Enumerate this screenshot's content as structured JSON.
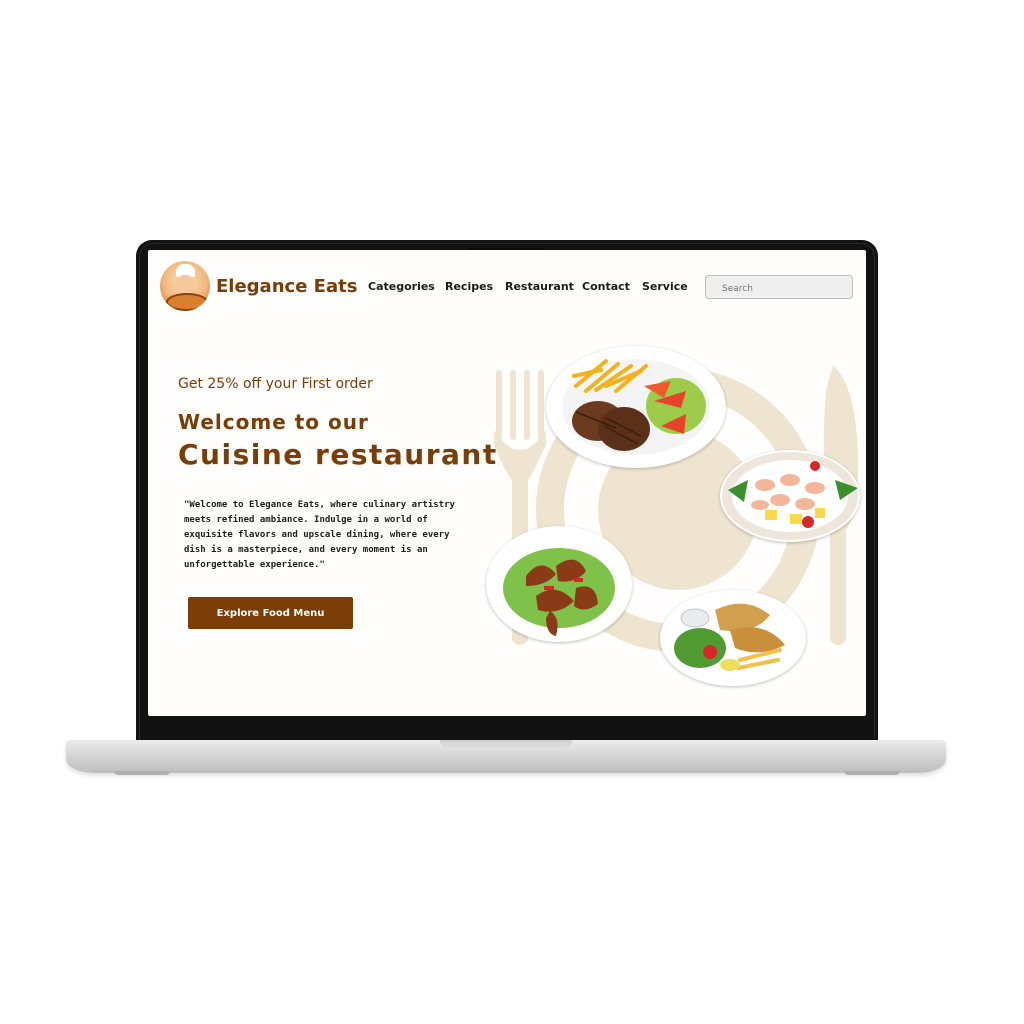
{
  "site": {
    "brand": "Elegance Eats",
    "nav_items": [
      "Categories",
      "Recipes",
      "Restaurant",
      "Contact",
      "Service"
    ],
    "search_placeholder": "Search"
  },
  "hero": {
    "promo": "Get 25% off your First order",
    "headline_line1": "Welcome to our",
    "headline_line2": "Cuisine restaurant",
    "description_lines": [
      "\"Welcome to Elegance Eats, where culinary artistry",
      "meets refined ambiance. Indulge in a world of",
      "exquisite flavors and upscale dining, where every",
      "dish is a masterpiece, and every moment is an",
      "unforgettable experience.\""
    ],
    "cta_label": "Explore Food Menu"
  },
  "colors": {
    "brand_brown": "#7a3d07",
    "decor_beige": "#efe4cf",
    "screen_bg": "#fffefc"
  },
  "icons": [
    "chef-logo-icon",
    "fork-plate-knife-icon"
  ]
}
